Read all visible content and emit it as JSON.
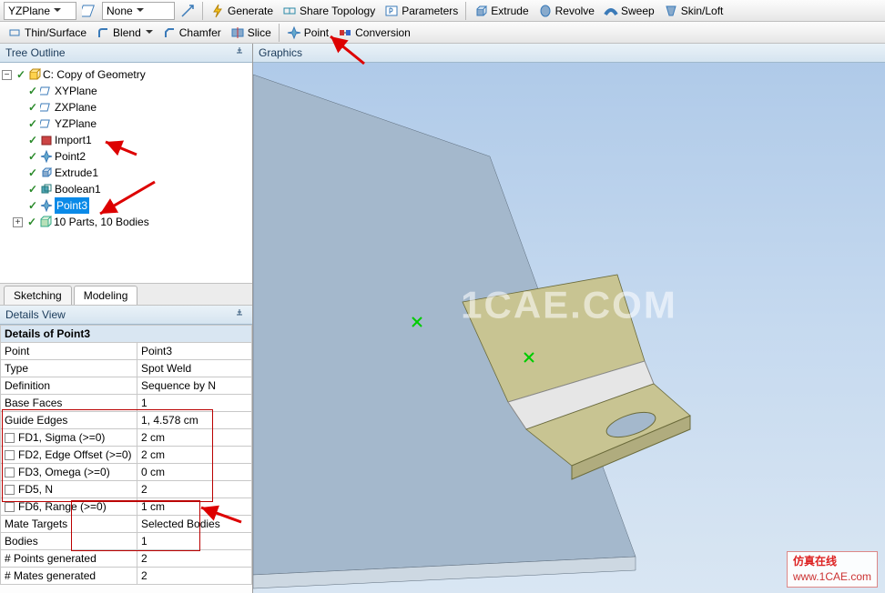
{
  "toolbar1": {
    "plane_combo": "YZPlane",
    "sketch_combo": "None",
    "generate": "Generate",
    "share_topology": "Share Topology",
    "parameters": "Parameters",
    "extrude": "Extrude",
    "revolve": "Revolve",
    "sweep": "Sweep",
    "skin_loft": "Skin/Loft"
  },
  "toolbar2": {
    "thin_surface": "Thin/Surface",
    "blend": "Blend",
    "chamfer": "Chamfer",
    "slice": "Slice",
    "point": "Point",
    "conversion": "Conversion"
  },
  "panels": {
    "tree_outline": "Tree Outline",
    "graphics": "Graphics",
    "details_view": "Details View"
  },
  "tree": {
    "root": "C: Copy of Geometry",
    "items": [
      "XYPlane",
      "ZXPlane",
      "YZPlane",
      "Import1",
      "Point2",
      "Extrude1",
      "Boolean1",
      "Point3"
    ],
    "parts": "10 Parts, 10 Bodies"
  },
  "tabs": {
    "sketching": "Sketching",
    "modeling": "Modeling"
  },
  "details": {
    "header": "Details of Point3",
    "rows": [
      {
        "k": "Point",
        "v": "Point3"
      },
      {
        "k": "Type",
        "v": "Spot Weld"
      },
      {
        "k": "Definition",
        "v": "Sequence by N"
      },
      {
        "k": "Base Faces",
        "v": "1"
      },
      {
        "k": "Guide Edges",
        "v": "1,  4.578 cm"
      }
    ],
    "fd_rows": [
      {
        "k": "FD1,  Sigma (>=0)",
        "v": "2 cm"
      },
      {
        "k": "FD2,  Edge Offset (>=0)",
        "v": "2 cm"
      },
      {
        "k": "FD3,  Omega (>=0)",
        "v": "0 cm"
      },
      {
        "k": "FD5,  N",
        "v": "2"
      },
      {
        "k": "FD6,  Range (>=0)",
        "v": "1 cm"
      }
    ],
    "tail_rows": [
      {
        "k": "Mate Targets",
        "v": "Selected Bodies"
      },
      {
        "k": "Bodies",
        "v": "1"
      },
      {
        "k": "# Points generated",
        "v": "2"
      },
      {
        "k": "# Mates generated",
        "v": "2"
      }
    ]
  },
  "watermarks": {
    "center": "1CAE.COM",
    "corner_cn": "仿真在线",
    "corner_url": "www.1CAE.com"
  }
}
